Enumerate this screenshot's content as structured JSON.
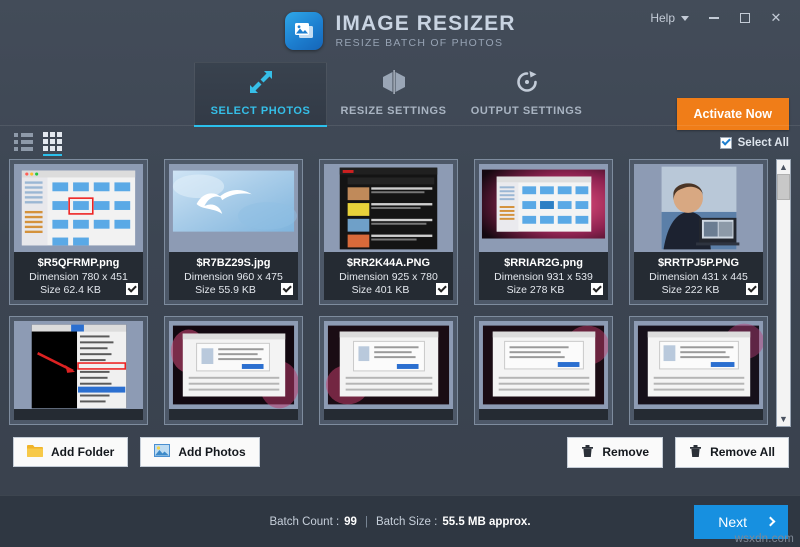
{
  "titlebar": {
    "app_title": "IMAGE RESIZER",
    "app_subtitle": "RESIZE BATCH OF PHOTOS",
    "help_label": "Help",
    "minimize_label": "",
    "maximize_label": "",
    "close_label": "✕"
  },
  "tabs": [
    {
      "label": "SELECT PHOTOS",
      "icon": "resize-arrows-icon",
      "active": true
    },
    {
      "label": "RESIZE SETTINGS",
      "icon": "flip-horizontal-icon",
      "active": false
    },
    {
      "label": "OUTPUT SETTINGS",
      "icon": "rotate-refresh-icon",
      "active": false
    }
  ],
  "activate_button": {
    "label": "Activate Now",
    "color": "#f07d18"
  },
  "viewbar": {
    "list_view_icon": "list-view-icon",
    "grid_view_icon": "grid-view-icon",
    "active_view": "grid",
    "select_all_label": "Select All",
    "select_all_checked": true
  },
  "photos": [
    {
      "name": "$R5QFRMP.png",
      "dimension": "Dimension 780 x 451",
      "size": "Size 62.4 KB",
      "checked": true,
      "thumb": "finder-window"
    },
    {
      "name": "$R7BZ29S.jpg",
      "dimension": "Dimension 960 x 475",
      "size": "Size 55.9 KB",
      "checked": true,
      "thumb": "sky-bird"
    },
    {
      "name": "$RR2K44A.PNG",
      "dimension": "Dimension 925 x 780",
      "size": "Size 401 KB",
      "checked": true,
      "thumb": "dark-video-list"
    },
    {
      "name": "$RRIAR2G.png",
      "dimension": "Dimension 931 x 539",
      "size": "Size 278 KB",
      "checked": true,
      "thumb": "finder-on-pink"
    },
    {
      "name": "$RRTPJ5P.PNG",
      "dimension": "Dimension 431 x 445",
      "size": "Size 222 KB",
      "checked": true,
      "thumb": "woman-laptop"
    },
    {
      "name": "",
      "dimension": "",
      "size": "",
      "checked": false,
      "thumb": "black-menu"
    },
    {
      "name": "",
      "dimension": "",
      "size": "",
      "checked": false,
      "thumb": "dialog-pink"
    },
    {
      "name": "",
      "dimension": "",
      "size": "",
      "checked": false,
      "thumb": "dialog-pink2"
    },
    {
      "name": "",
      "dimension": "",
      "size": "",
      "checked": false,
      "thumb": "dialog-white"
    },
    {
      "name": "",
      "dimension": "",
      "size": "",
      "checked": false,
      "thumb": "dialog-white2"
    }
  ],
  "actionbar": {
    "add_folder_label": "Add Folder",
    "add_photos_label": "Add Photos",
    "remove_label": "Remove",
    "remove_all_label": "Remove All"
  },
  "footer": {
    "batch_count_label": "Batch Count :",
    "batch_count_value": "99",
    "separator": "|",
    "batch_size_label": "Batch Size :",
    "batch_size_value": "55.5 MB approx.",
    "next_label": "Next"
  },
  "watermark": "wsxdn.com"
}
